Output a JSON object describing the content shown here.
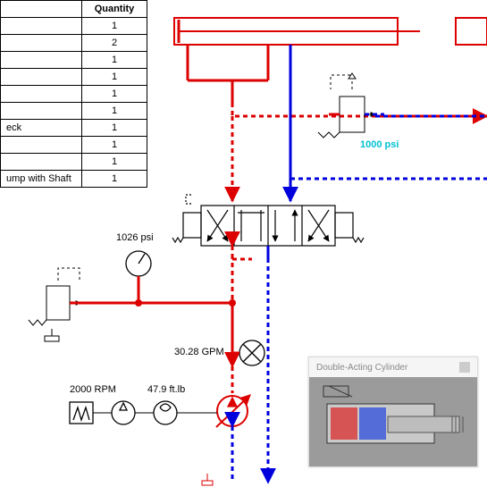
{
  "table": {
    "header_qty": "Quantity",
    "rows": [
      {
        "desc": "",
        "qty": "1"
      },
      {
        "desc": "",
        "qty": "2"
      },
      {
        "desc": "",
        "qty": "1"
      },
      {
        "desc": "",
        "qty": "1"
      },
      {
        "desc": "",
        "qty": "1"
      },
      {
        "desc": "",
        "qty": "1"
      },
      {
        "desc": "eck",
        "qty": "1"
      },
      {
        "desc": "",
        "qty": "1"
      },
      {
        "desc": "",
        "qty": "1"
      },
      {
        "desc": "ump with Shaft",
        "qty": "1"
      }
    ]
  },
  "labels": {
    "pressure_gauge": "1026 psi",
    "regulator_pressure": "1000 psi",
    "flow_rate": "30.28 GPM",
    "motor_speed": "2000 RPM",
    "torque": "47.9 ft.lb"
  },
  "tooltip": {
    "title": "Double-Acting Cylinder"
  }
}
